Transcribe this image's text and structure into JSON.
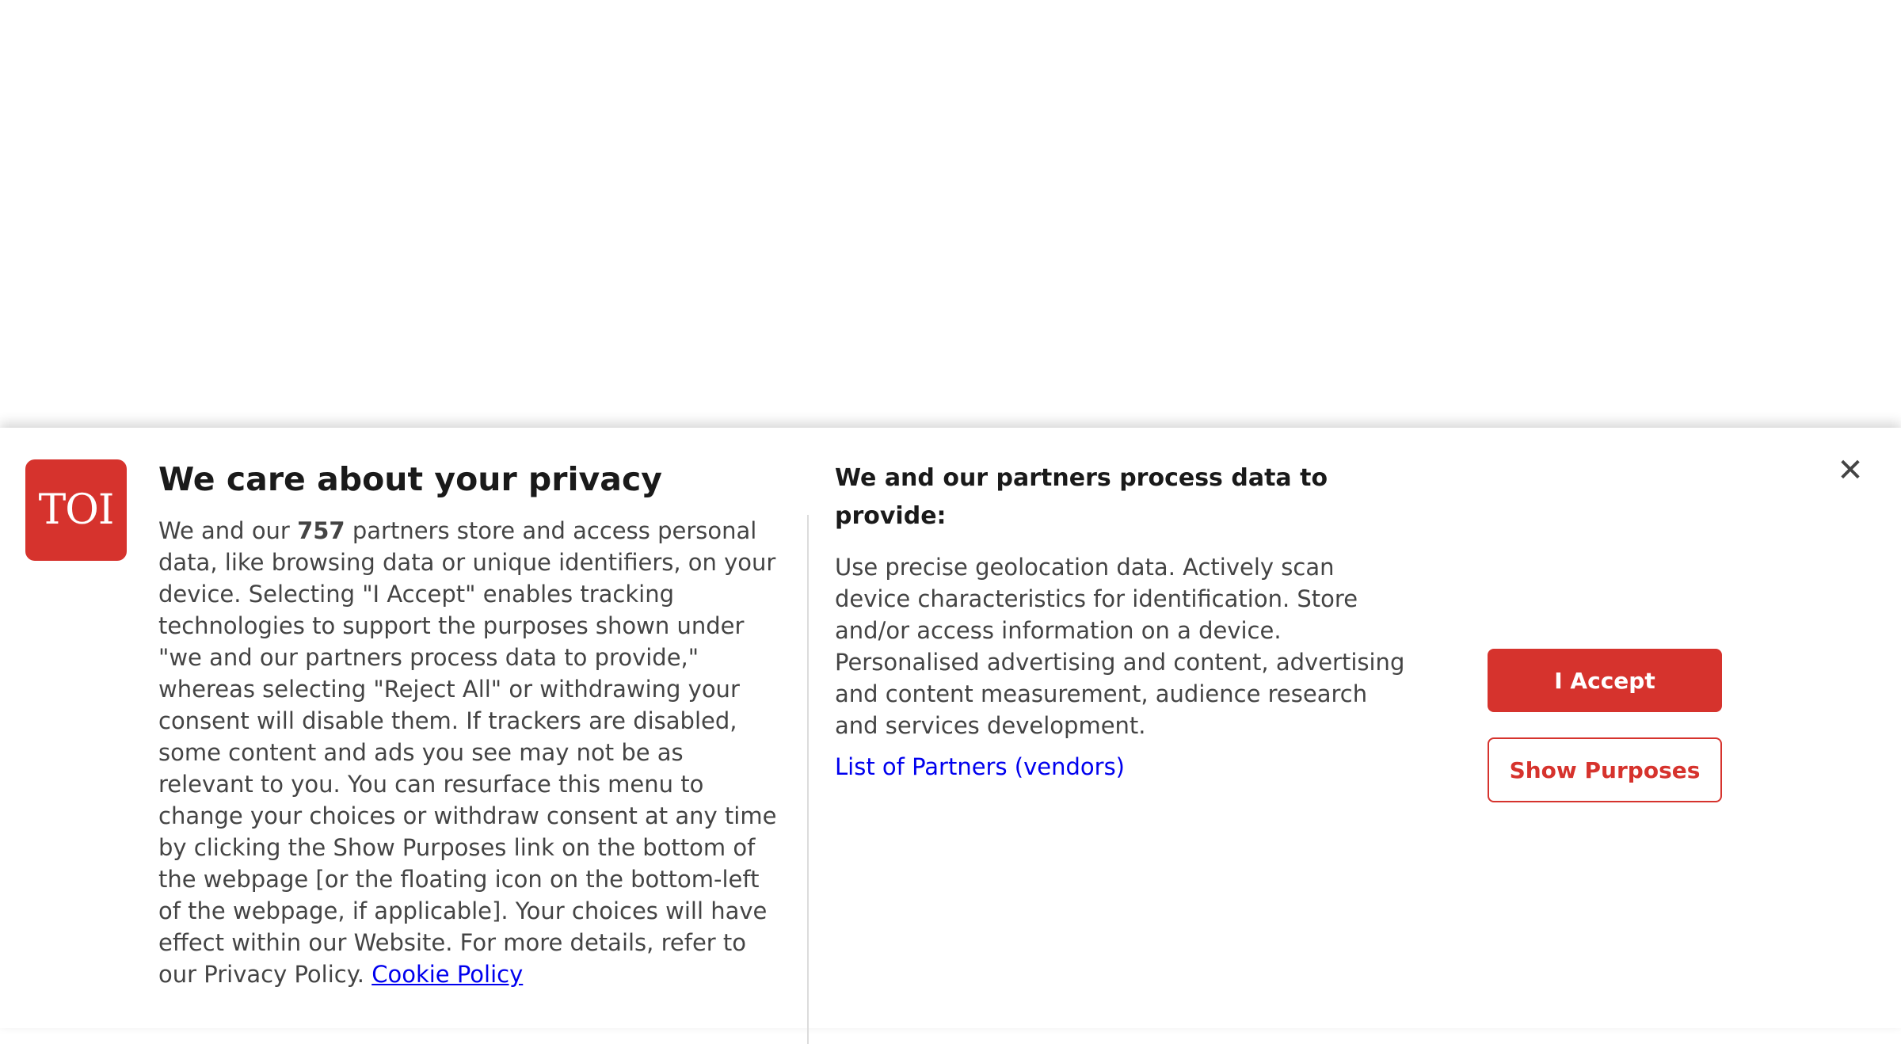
{
  "brand": {
    "logo_text": "TOI",
    "accent_color": "#d6332d"
  },
  "consent": {
    "title": "We care about your privacy",
    "description_prefix": "We and our ",
    "partner_count": "757",
    "description_body": " partners store and access personal data, like browsing data or unique identifiers, on your device. Selecting \"I Accept\" enables tracking technologies to support the purposes shown under \"we and our partners process data to provide,\" whereas selecting \"Reject All\" or withdrawing your consent will disable them. If trackers are disabled, some content and ads you see may not be as relevant to you. You can resurface this menu to change your choices or withdraw consent at any time by clicking the Show Purposes link on the bottom of the webpage [or the floating icon on the bottom-left of the webpage, if applicable]. Your choices will have effect within our Website. For more details, refer to our Privacy Policy. ",
    "cookie_policy_link": "Cookie Policy"
  },
  "purposes": {
    "heading": "We and our partners process data to provide:",
    "text": "Use precise geolocation data. Actively scan device characteristics for identification. Store and/or access information on a device. Personalised advertising and content, advertising and content measurement, audience research and services development.",
    "vendors_link": "List of Partners (vendors)"
  },
  "actions": {
    "accept_label": "I Accept",
    "show_purposes_label": "Show Purposes",
    "close_glyph": "✕"
  },
  "icons": {
    "close": "close-icon"
  }
}
